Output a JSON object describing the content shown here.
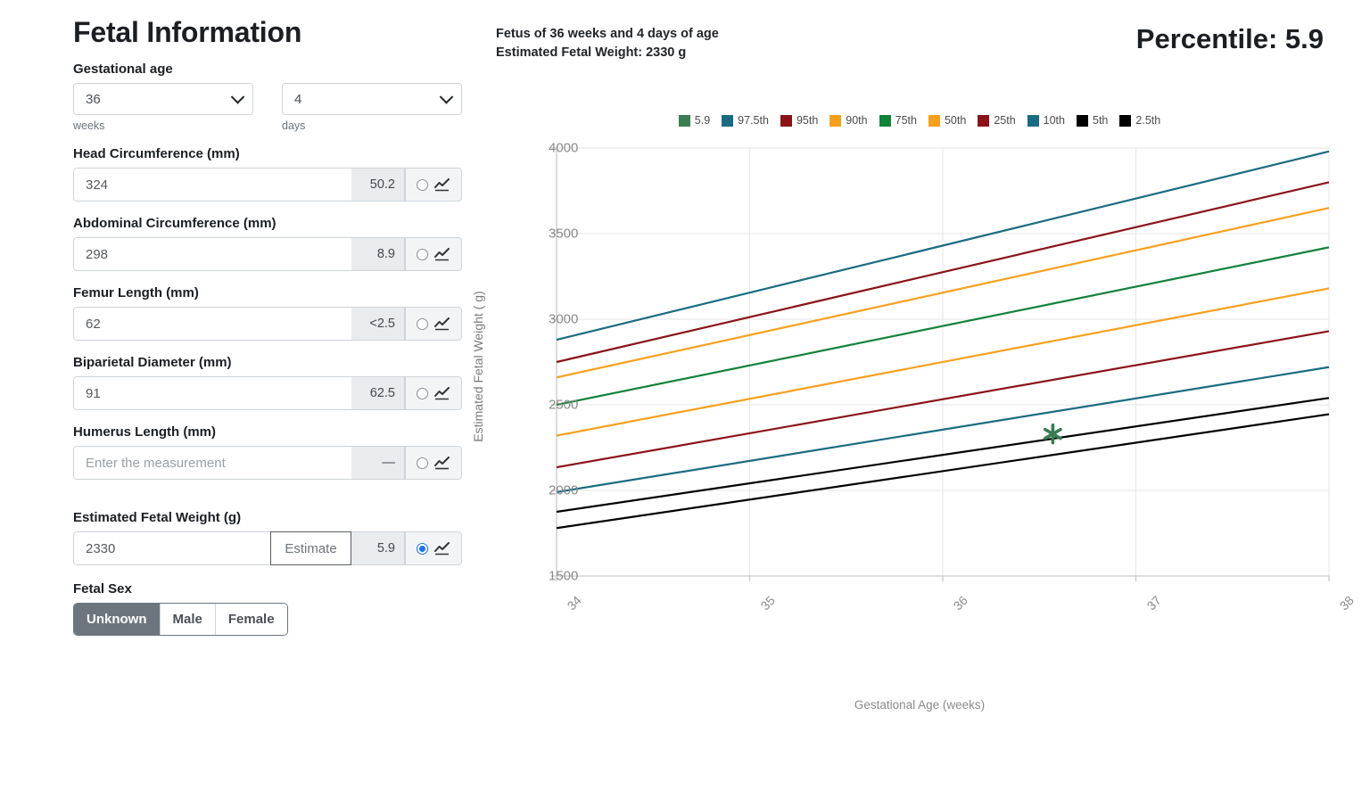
{
  "panel": {
    "title": "Fetal Information",
    "gestational_age": {
      "label": "Gestational age",
      "weeks_value": "36",
      "weeks_sublabel": "weeks",
      "days_value": "4",
      "days_sublabel": "days"
    },
    "measurements": [
      {
        "label": "Head Circumference (mm)",
        "value": "324",
        "placeholder": "Enter the measurement",
        "percentile": "50.2",
        "selected": false
      },
      {
        "label": "Abdominal Circumference (mm)",
        "value": "298",
        "placeholder": "Enter the measurement",
        "percentile": "8.9",
        "selected": false
      },
      {
        "label": "Femur Length (mm)",
        "value": "62",
        "placeholder": "Enter the measurement",
        "percentile": "<2.5",
        "selected": false
      },
      {
        "label": "Biparietal Diameter (mm)",
        "value": "91",
        "placeholder": "Enter the measurement",
        "percentile": "62.5",
        "selected": false
      },
      {
        "label": "Humerus Length (mm)",
        "value": "",
        "placeholder": "Enter the measurement",
        "percentile": "—",
        "selected": false
      }
    ],
    "efw": {
      "label": "Estimated Fetal Weight (g)",
      "value": "2330",
      "estimate_button": "Estimate",
      "percentile": "5.9",
      "selected": true
    },
    "fetal_sex": {
      "label": "Fetal Sex",
      "options": [
        "Unknown",
        "Male",
        "Female"
      ],
      "selected": "Unknown"
    }
  },
  "header": {
    "age_line": "Fetus of 36 weeks and 4 days of age",
    "weight_line": "Estimated Fetal Weight: 2330 g",
    "percentile_label": "Percentile: 5.9"
  },
  "colors": {
    "current": "#3a7d52",
    "p97_5": "#1a6b82",
    "p95": "#8b1318",
    "p90": "#f7a01d",
    "p75": "#13823b",
    "p50": "#f7a01d",
    "p25": "#8b1318",
    "p10": "#1a6b82",
    "p5": "#000000",
    "p2_5": "#000000",
    "selected_radio": "#1a73e8",
    "active_segment": "#6c757d"
  },
  "chart_data": {
    "type": "line",
    "title": "",
    "xlabel": "Gestational Age (weeks)",
    "ylabel": "Estimated Fetal Weight ( g)",
    "xlim": [
      34,
      38
    ],
    "ylim": [
      1500,
      4000
    ],
    "xticks": [
      34,
      35,
      36,
      37,
      38
    ],
    "yticks": [
      1500,
      2000,
      2500,
      3000,
      3500,
      4000
    ],
    "grid": true,
    "legend_position": "top-center",
    "legend": [
      "5.9",
      "97.5th",
      "95th",
      "90th",
      "75th",
      "50th",
      "25th",
      "10th",
      "5th",
      "2.5th"
    ],
    "x": [
      34,
      38
    ],
    "series": [
      {
        "name": "97.5th",
        "color": "#1a6b82",
        "values": [
          2880,
          3980
        ]
      },
      {
        "name": "95th",
        "color": "#8b1318",
        "values": [
          2750,
          3800
        ]
      },
      {
        "name": "90th",
        "color": "#f7a01d",
        "values": [
          2660,
          3650
        ]
      },
      {
        "name": "75th",
        "color": "#13823b",
        "values": [
          2500,
          3420
        ]
      },
      {
        "name": "50th",
        "color": "#f7a01d",
        "values": [
          2320,
          3180
        ]
      },
      {
        "name": "25th",
        "color": "#8b1318",
        "values": [
          2135,
          2930
        ]
      },
      {
        "name": "10th",
        "color": "#1a6b82",
        "values": [
          1990,
          2720
        ]
      },
      {
        "name": "5th",
        "color": "#000000",
        "values": [
          1875,
          2540
        ]
      },
      {
        "name": "2.5th",
        "color": "#000000",
        "values": [
          1780,
          2445
        ]
      }
    ],
    "point": {
      "name": "5.9",
      "color": "#3a7d52",
      "x": 36.57,
      "y": 2330,
      "marker": "asterisk"
    }
  }
}
